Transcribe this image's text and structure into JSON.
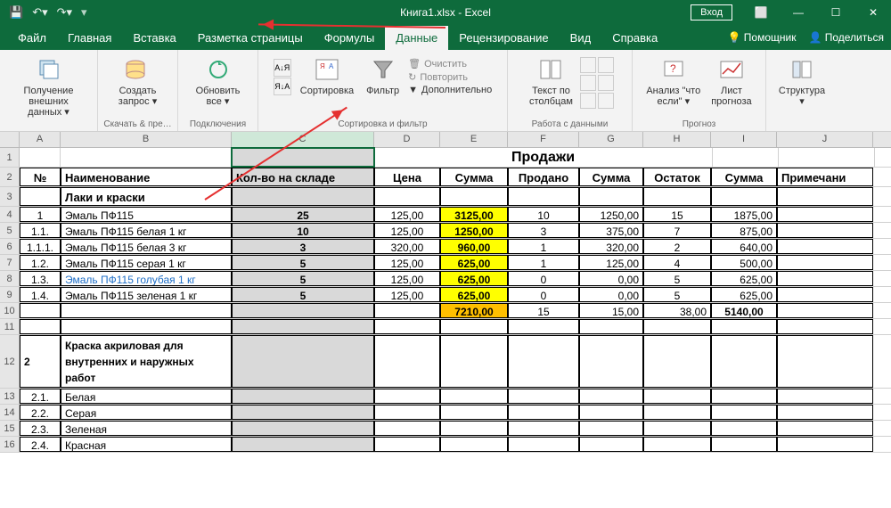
{
  "title": {
    "filename": "Книга1.xlsx",
    "app": "Excel"
  },
  "login": "Вход",
  "menu": {
    "items": [
      "Файл",
      "Главная",
      "Вставка",
      "Разметка страницы",
      "Формулы",
      "Данные",
      "Рецензирование",
      "Вид",
      "Справка"
    ],
    "active": "Данные",
    "assistant": "Помощник",
    "share": "Поделиться"
  },
  "ribbon": {
    "g1": {
      "label": "",
      "btn": "Получение\nвнешних данных ▾"
    },
    "g2": {
      "label": "Скачать & пре…",
      "btn": "Создать\nзапрос ▾"
    },
    "g3": {
      "label": "Подключения",
      "btn": "Обновить\nвсе ▾"
    },
    "g4": {
      "label": "Сортировка и фильтр",
      "sort": "Сортировка",
      "filter": "Фильтр",
      "mini1": "Очистить",
      "mini2": "Повторить",
      "mini3": "Дополнительно"
    },
    "g5": {
      "label": "Работа с данными",
      "btn": "Текст по\nстолбцам"
    },
    "g6": {
      "label": "Прогноз",
      "what": "Анализ \"что\nесли\" ▾",
      "fcast": "Лист\nпрогноза"
    },
    "g7": {
      "label": "",
      "btn": "Структура\n▾"
    }
  },
  "cols": [
    "A",
    "B",
    "C",
    "D",
    "E",
    "F",
    "G",
    "H",
    "I",
    "J"
  ],
  "widths": [
    46,
    192,
    160,
    74,
    76,
    80,
    72,
    76,
    74,
    108
  ],
  "sheet": {
    "title": "Продажи",
    "headers": [
      "№",
      "Наименование",
      "Кол-во на складе",
      "Цена",
      "Сумма",
      "Продано",
      "Сумма",
      "Остаток",
      "Сумма",
      "Примечани"
    ],
    "section1": "Лаки и  краски",
    "rows": [
      {
        "n": "1",
        "name": "Эмаль ПФ115",
        "qty": "25",
        "price": "125,00",
        "sum1": "3125,00",
        "sold": "10",
        "sum2": "1250,00",
        "rest": "15",
        "sum3": "1875,00"
      },
      {
        "n": "1.1.",
        "name": "Эмаль ПФ115 белая 1 кг",
        "qty": "10",
        "price": "125,00",
        "sum1": "1250,00",
        "sold": "3",
        "sum2": "375,00",
        "rest": "7",
        "sum3": "875,00"
      },
      {
        "n": "1.1.1.",
        "name": "Эмаль ПФ115 белая 3 кг",
        "qty": "3",
        "price": "320,00",
        "sum1": "960,00",
        "sold": "1",
        "sum2": "320,00",
        "rest": "2",
        "sum3": "640,00"
      },
      {
        "n": "1.2.",
        "name": "Эмаль ПФ115 серая 1 кг",
        "qty": "5",
        "price": "125,00",
        "sum1": "625,00",
        "sold": "1",
        "sum2": "125,00",
        "rest": "4",
        "sum3": "500,00"
      },
      {
        "n": "1.3.",
        "name": "Эмаль ПФ115 голубая 1 кг",
        "qty": "5",
        "price": "125,00",
        "sum1": "625,00",
        "sold": "0",
        "sum2": "0,00",
        "rest": "5",
        "sum3": "625,00",
        "hl": true
      },
      {
        "n": "1.4.",
        "name": "Эмаль ПФ115 зеленая 1 кг",
        "qty": "5",
        "price": "125,00",
        "sum1": "625,00",
        "sold": "0",
        "sum2": "0,00",
        "rest": "5",
        "sum3": "625,00"
      }
    ],
    "totals": {
      "sum1": "7210,00",
      "sold": "15",
      "sum2": "15,00",
      "rest": "38,00",
      "sum3": "5140,00"
    },
    "section2": {
      "n": "2",
      "name": "Краска акриловая для внутренних и наружных работ"
    },
    "rows2": [
      {
        "n": "2.1.",
        "name": "Белая"
      },
      {
        "n": "2.2.",
        "name": "Серая"
      },
      {
        "n": "2.3.",
        "name": "Зеленая"
      },
      {
        "n": "2.4.",
        "name": "Красная"
      }
    ]
  }
}
